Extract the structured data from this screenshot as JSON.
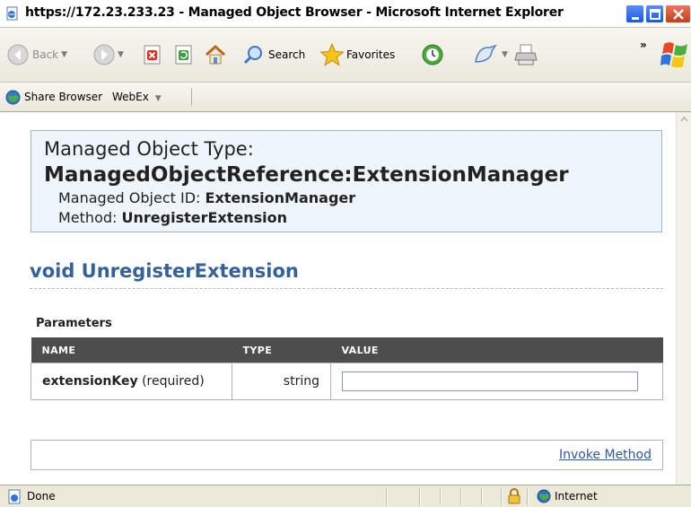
{
  "window": {
    "title": "https://172.23.233.23 - Managed Object Browser - Microsoft Internet Explorer"
  },
  "toolbar": {
    "back_label": "Back",
    "search_label": "Search",
    "favorites_label": "Favorites",
    "overflow_label": "»"
  },
  "links_bar": {
    "share_browser_label": "Share Browser",
    "webex_label": "WebEx"
  },
  "page": {
    "object_type_label": "Managed Object Type:",
    "object_type_value": "ManagedObjectReference:ExtensionManager",
    "object_id_label": "Managed Object ID:",
    "object_id_value": "ExtensionManager",
    "method_label": "Method:",
    "method_value": "UnregisterExtension",
    "method_signature": "void UnregisterExtension",
    "parameters_heading": "Parameters",
    "columns": [
      "NAME",
      "TYPE",
      "VALUE"
    ],
    "parameters": [
      {
        "name": "extensionKey",
        "qualifier": "(required)",
        "type": "string",
        "value": ""
      }
    ],
    "invoke_label": "Invoke Method"
  },
  "status_bar": {
    "status": "Done",
    "zone": "Internet"
  }
}
